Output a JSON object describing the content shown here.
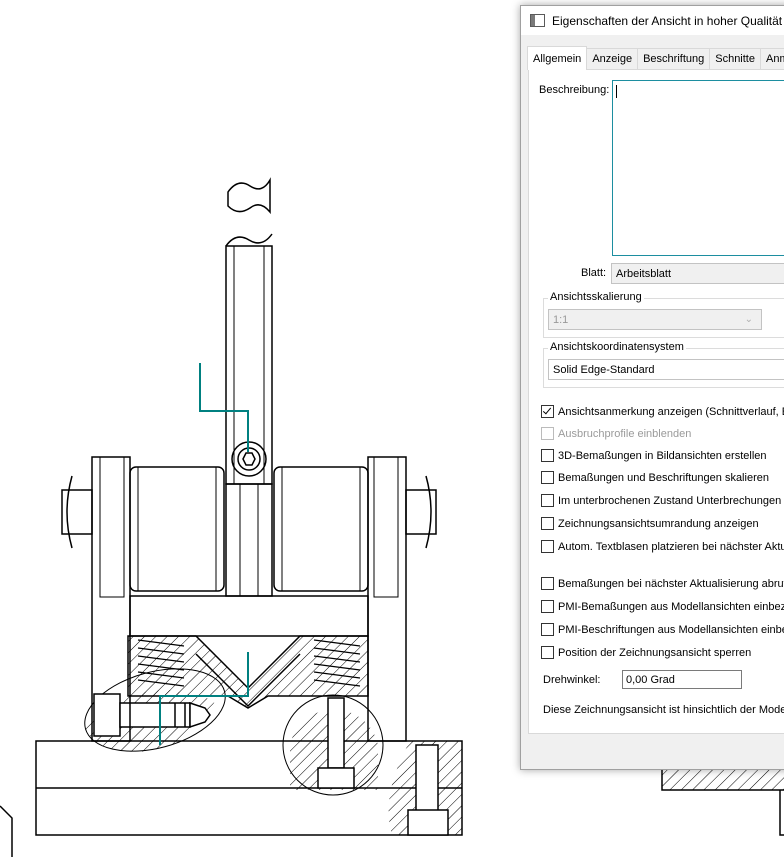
{
  "dialog": {
    "title": "Eigenschaften der Ansicht in hoher Qualität -",
    "tabs": [
      {
        "label": "Allgemein",
        "active": true
      },
      {
        "label": "Anzeige"
      },
      {
        "label": "Beschriftung"
      },
      {
        "label": "Schnitte"
      },
      {
        "label": "Anm"
      }
    ],
    "beschreibung_label": "Beschreibung:",
    "beschreibung_value": "",
    "blatt_label": "Blatt:",
    "blatt_value": "Arbeitsblatt",
    "scale_group_title": "Ansichtsskalierung",
    "scale_value": "1:1",
    "coord_group_title": "Ansichtskoordinatensystem",
    "coord_value": "Solid Edge-Standard",
    "checkboxes": [
      {
        "label": "Ansichtsanmerkung anzeigen (Schnittverlauf, Ein",
        "checked": true,
        "enabled": true
      },
      {
        "label": "Ausbruchprofile einblenden",
        "checked": false,
        "enabled": false
      },
      {
        "label": "3D-Bemaßungen in Bildansichten erstellen",
        "checked": false,
        "enabled": true
      },
      {
        "label": "Bemaßungen und Beschriftungen skalieren",
        "checked": false,
        "enabled": true
      },
      {
        "label": "Im unterbrochenen Zustand Unterbrechungen au",
        "checked": false,
        "enabled": true
      },
      {
        "label": "Zeichnungsansichtsumrandung anzeigen",
        "checked": false,
        "enabled": true
      },
      {
        "label": "Autom. Textblasen platzieren bei nächster Aktua",
        "checked": false,
        "enabled": true
      },
      {
        "label": "Bemaßungen bei nächster Aktualisierung abrufen",
        "checked": false,
        "enabled": true
      },
      {
        "label": "PMI-Bemaßungen aus Modellansichten einbezie",
        "checked": false,
        "enabled": true
      },
      {
        "label": "PMI-Beschriftungen aus Modellansichten einbezi",
        "checked": false,
        "enabled": true
      },
      {
        "label": "Position der Zeichnungsansicht sperren",
        "checked": false,
        "enabled": true
      }
    ],
    "drehwinkel_label": "Drehwinkel:",
    "drehwinkel_value": "0,00 Grad",
    "footer_text": "Diese Zeichnungsansicht ist hinsichtlich der Modellg"
  },
  "colors": {
    "accent": "#1c8ea0",
    "annotation_line": "#008080"
  }
}
